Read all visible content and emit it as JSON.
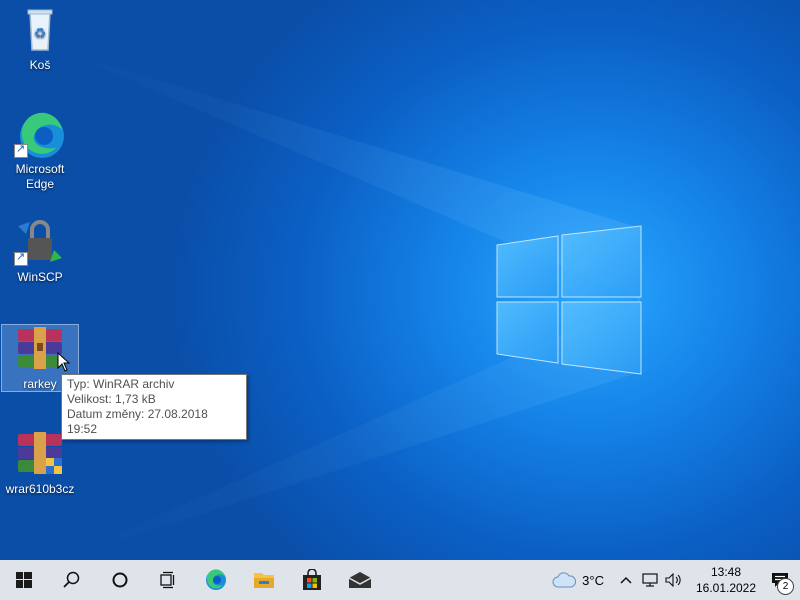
{
  "desktop": {
    "icons": [
      {
        "label": "Koš",
        "icon": "recycle-bin-icon"
      },
      {
        "label": "Microsoft Edge",
        "icon": "edge-icon"
      },
      {
        "label": "WinSCP",
        "icon": "winscp-icon"
      },
      {
        "label": "rarkey",
        "icon": "winrar-archive-icon"
      },
      {
        "label": "wrar610b3cz",
        "icon": "winrar-installer-icon"
      }
    ]
  },
  "tooltip": {
    "line1": "Typ: WinRAR archiv",
    "line2": "Velikost: 1,73 kB",
    "line3": "Datum změny: 27.08.2018 19:52"
  },
  "taskbar": {
    "buttons": [
      "start-icon",
      "search-icon",
      "cortana-icon",
      "task-view-icon",
      "edge-icon",
      "file-explorer-icon",
      "store-icon",
      "mail-icon"
    ],
    "weather": {
      "temp": "3°C",
      "icon": "cloud-icon"
    },
    "clock": {
      "time": "13:48",
      "date": "16.01.2022"
    },
    "notifications": {
      "count": "2"
    }
  },
  "colors": {
    "desktop": "#1583e8",
    "taskbar": "#dfe3ea"
  }
}
